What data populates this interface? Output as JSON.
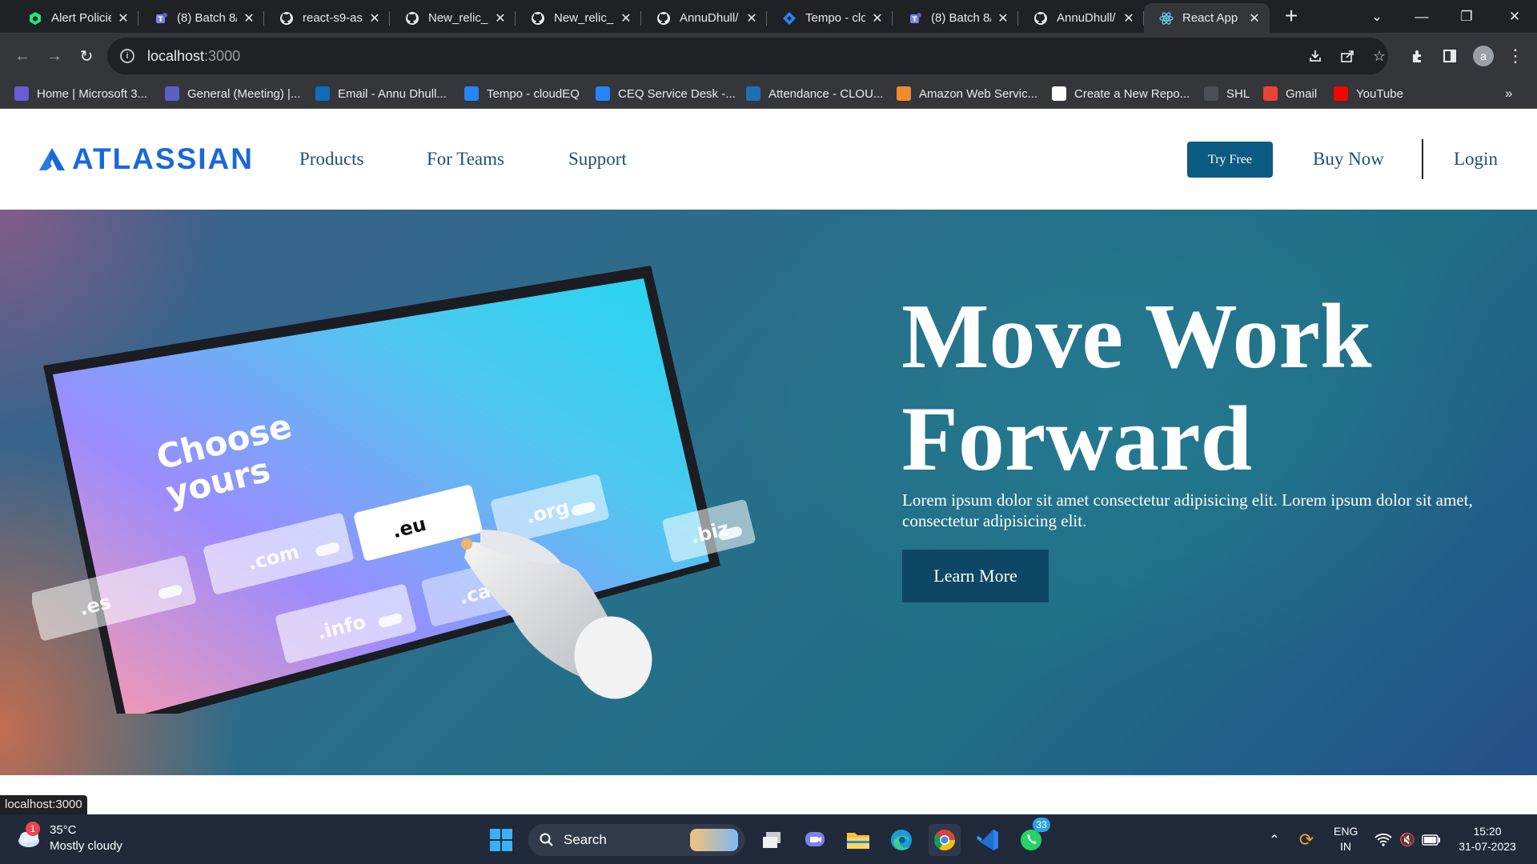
{
  "browser": {
    "tabs": [
      {
        "title": "Alert Policie",
        "icon": "newrelic-icon"
      },
      {
        "title": "(8) Batch 8/",
        "icon": "teams-icon"
      },
      {
        "title": "react-s9-as",
        "icon": "github-icon"
      },
      {
        "title": "New_relic_C",
        "icon": "github-icon"
      },
      {
        "title": "New_relic_a",
        "icon": "github-icon"
      },
      {
        "title": "AnnuDhull/",
        "icon": "github-icon"
      },
      {
        "title": "Tempo - clo",
        "icon": "jira-icon"
      },
      {
        "title": "(8) Batch 8/",
        "icon": "teams-icon"
      },
      {
        "title": "AnnuDhull/",
        "icon": "github-icon"
      },
      {
        "title": "React App",
        "icon": "react-icon",
        "active": true
      }
    ],
    "address": {
      "host": "localhost",
      "port": ":3000"
    },
    "bookmarks": [
      {
        "label": "Home | Microsoft 3...",
        "color": "#6b5cd6"
      },
      {
        "label": "General (Meeting) |...",
        "color": "#5b5fc7"
      },
      {
        "label": "Email - Annu Dhull...",
        "color": "#0f6cbd"
      },
      {
        "label": "Tempo - cloudEQ",
        "color": "#2684ff"
      },
      {
        "label": "CEQ Service Desk -...",
        "color": "#2684ff"
      },
      {
        "label": "Attendance - CLOU...",
        "color": "#1f6fb5"
      },
      {
        "label": "Amazon Web Servic...",
        "color": "#f28a2e"
      },
      {
        "label": "Create a New Repo...",
        "color": "#ffffff"
      },
      {
        "label": "SHL",
        "color": "#4b4f56"
      },
      {
        "label": "Gmail",
        "color": "#ea4335"
      },
      {
        "label": "YouTube",
        "color": "#ff0000"
      }
    ],
    "status_url": "localhost:3000",
    "profile_initial": "a"
  },
  "site": {
    "logo": "ATLASSIAN",
    "nav": [
      "Products",
      "For Teams",
      "Support"
    ],
    "try_free": "Try Free",
    "buy_now": "Buy Now",
    "login": "Login",
    "hero": {
      "title": "Move Work Forward",
      "text": "Lorem ipsum dolor sit amet consectetur adipisicing elit. Lorem ipsum dolor sit amet, consectetur adipisicing elit.",
      "cta": "Learn More"
    },
    "illustration": {
      "screen_text": [
        "Choose",
        "yours"
      ],
      "domains": [
        ".es",
        ".com",
        ".eu",
        ".org",
        ".info",
        ".cat",
        ".biz"
      ]
    },
    "colors": {
      "brand": "#1868db",
      "button": "#0b5a82",
      "cta": "#0e4766"
    }
  },
  "taskbar": {
    "weather": {
      "temp": "35°C",
      "desc": "Mostly cloudy",
      "badge": "1"
    },
    "search": "Search",
    "whatsapp_badge": "33",
    "lang": [
      "ENG",
      "IN"
    ],
    "time": "15:20",
    "date": "31-07-2023"
  }
}
